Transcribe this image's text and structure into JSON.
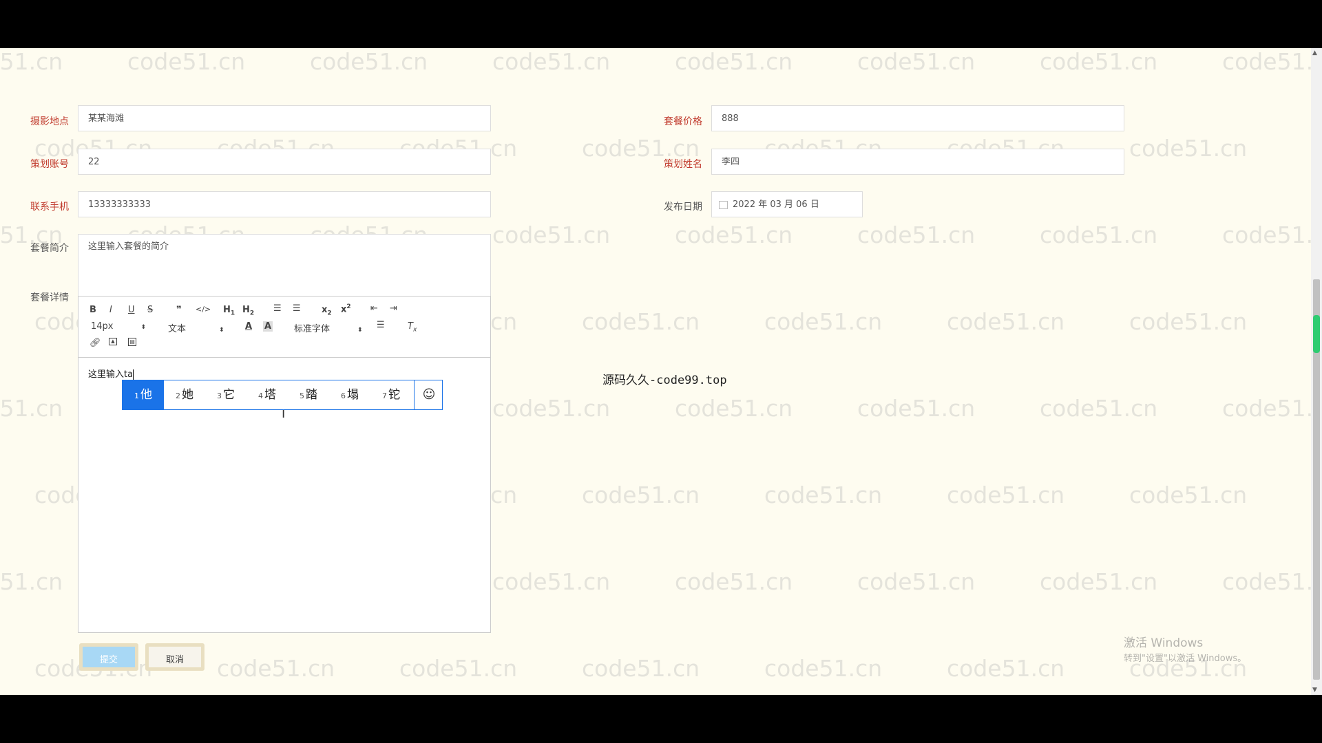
{
  "form": {
    "shoot_location": {
      "label": "摄影地点",
      "value": "某某海滩"
    },
    "package_price": {
      "label": "套餐价格",
      "value": "888"
    },
    "planner_account": {
      "label": "策划账号",
      "value": "22"
    },
    "planner_name": {
      "label": "策划姓名",
      "value": "李四"
    },
    "contact_phone": {
      "label": "联系手机",
      "value": "13333333333"
    },
    "publish_date": {
      "label": "发布日期",
      "value": "2022 年 03 月 06 日"
    },
    "package_intro": {
      "label": "套餐简介",
      "value": "这里输入套餐的简介"
    },
    "package_detail": {
      "label": "套餐详情",
      "value": "这里输入ta"
    }
  },
  "editor_toolbar": {
    "row1": [
      "B",
      "I",
      "U",
      "S",
      "99",
      "</>",
      "H1",
      "H2",
      "ol",
      "ul",
      "x2",
      "x²",
      "outdent",
      "indent"
    ],
    "font_size": "14px",
    "text_type": "文本",
    "font_family": "标准字体",
    "icons": [
      "bold-icon",
      "italic-icon",
      "underline-icon",
      "strike-icon",
      "quote-icon",
      "code-icon",
      "h1-icon",
      "h2-icon",
      "ordered-list-icon",
      "bullet-list-icon",
      "subscript-icon",
      "superscript-icon",
      "outdent-icon",
      "indent-icon",
      "font-color-icon",
      "background-color-icon",
      "align-icon",
      "clear-format-icon",
      "link-icon",
      "image-icon",
      "video-icon"
    ]
  },
  "ime": {
    "candidates": [
      {
        "n": "1",
        "c": "他"
      },
      {
        "n": "2",
        "c": "她"
      },
      {
        "n": "3",
        "c": "它"
      },
      {
        "n": "4",
        "c": "塔"
      },
      {
        "n": "5",
        "c": "踏"
      },
      {
        "n": "6",
        "c": "塌"
      },
      {
        "n": "7",
        "c": "铊"
      }
    ],
    "emoji_icon": "smiley-icon"
  },
  "buttons": {
    "submit": "提交",
    "cancel": "取消"
  },
  "center_text": "源码久久-code99.top",
  "watermark": "code51.cn",
  "windows_activation": {
    "line1": "激活 Windows",
    "line2": "转到\"设置\"以激活 Windows。"
  },
  "colors": {
    "background": "#fefcf0",
    "required_label": "#c0392b",
    "ime_highlight": "#1a73e8"
  }
}
